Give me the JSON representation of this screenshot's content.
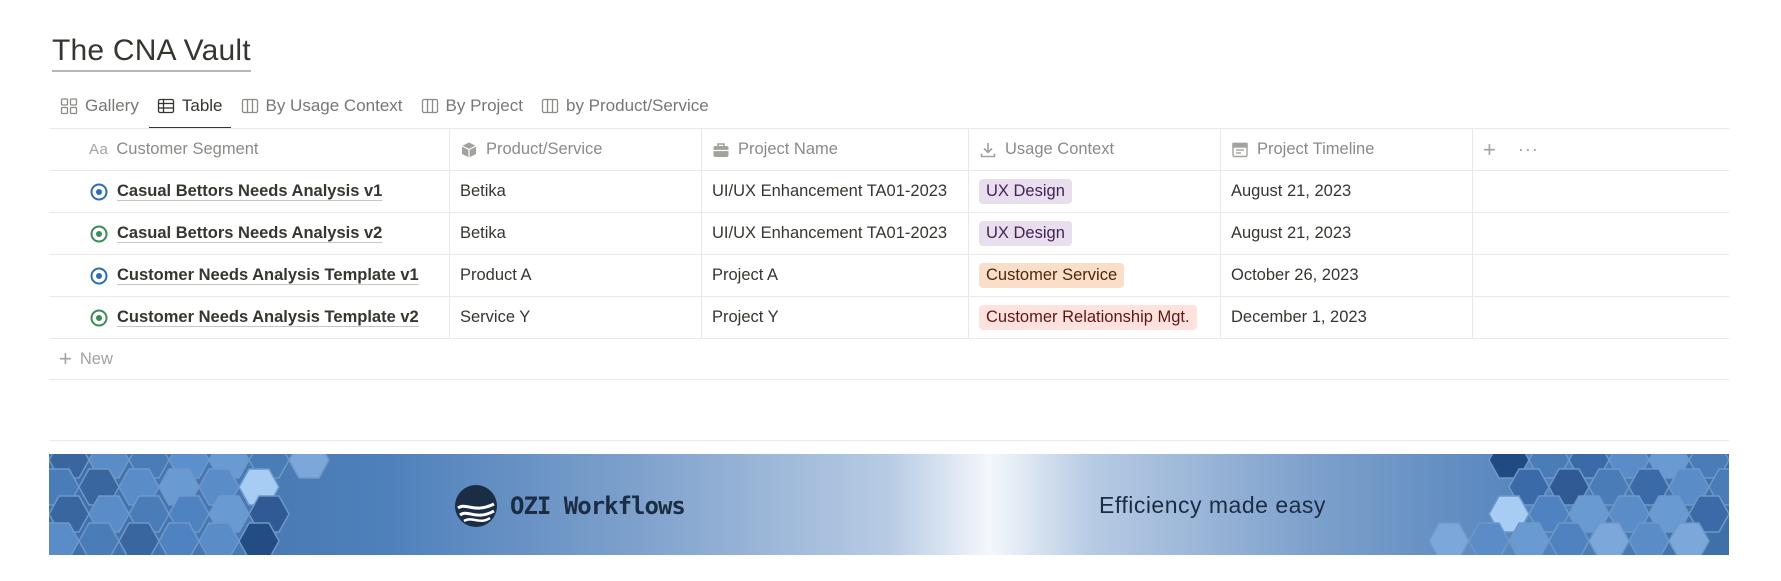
{
  "page": {
    "title": "The CNA Vault"
  },
  "tabs": [
    {
      "label": "Gallery",
      "icon": "gallery-grid-icon",
      "active": false
    },
    {
      "label": "Table",
      "icon": "table-icon",
      "active": true
    },
    {
      "label": "By Usage Context",
      "icon": "board-icon",
      "active": false
    },
    {
      "label": "By Project",
      "icon": "board-icon",
      "active": false
    },
    {
      "label": "by Product/Service",
      "icon": "board-icon",
      "active": false
    }
  ],
  "table": {
    "columns": [
      {
        "label": "Customer Segment",
        "icon": "text-type-icon",
        "icon_text": "Aa"
      },
      {
        "label": "Product/Service",
        "icon": "cube-icon"
      },
      {
        "label": "Project Name",
        "icon": "briefcase-icon"
      },
      {
        "label": "Usage Context",
        "icon": "download-icon"
      },
      {
        "label": "Project Timeline",
        "icon": "calendar-icon"
      }
    ],
    "rows": [
      {
        "segment": "Casual Bettors Needs Analysis v1",
        "page_icon_color": "#2e6db3",
        "product": "Betika",
        "project": "UI/UX Enhancement TA01-2023",
        "usage": "UX Design",
        "usage_bg": "#e8deee",
        "usage_fg": "#412454",
        "timeline": "August 21, 2023"
      },
      {
        "segment": "Casual Bettors Needs Analysis v2",
        "page_icon_color": "#3d8a5a",
        "product": "Betika",
        "project": "UI/UX Enhancement TA01-2023",
        "usage": "UX Design",
        "usage_bg": "#e8deee",
        "usage_fg": "#412454",
        "timeline": "August 21, 2023"
      },
      {
        "segment": "Customer Needs Analysis Template v1",
        "page_icon_color": "#2e6db3",
        "product": "Product A",
        "project": "Project A",
        "usage": "Customer Service",
        "usage_bg": "#fadec9",
        "usage_fg": "#49290e",
        "timeline": "October 26, 2023"
      },
      {
        "segment": "Customer Needs Analysis Template v2",
        "page_icon_color": "#3d8a5a",
        "product": "Service Y",
        "project": "Project Y",
        "usage": "Customer Relationship Mgt.",
        "usage_bg": "#ffe2dd",
        "usage_fg": "#5d1715",
        "timeline": "December 1, 2023"
      }
    ],
    "new_label": "New",
    "add_icon": "plus-icon",
    "more_icon": "more-horizontal-icon"
  },
  "banner": {
    "brand": "OZI Workflows",
    "tagline": "Efficiency made easy",
    "colors": {
      "dark": "#1b2d45",
      "blue": "#4e80bb",
      "light": "#f4f7fb"
    }
  }
}
